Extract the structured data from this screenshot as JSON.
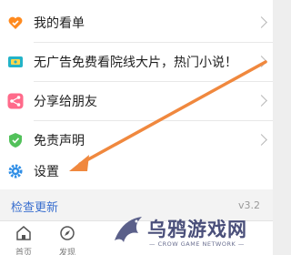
{
  "menu": {
    "items": [
      {
        "label": "我的看单",
        "icon": "heart-icon",
        "color": "#ff8a1f"
      },
      {
        "label": "无广告免费看院线大片，热门小说！",
        "icon": "ticket-icon",
        "color": "#23b3c8"
      },
      {
        "label": "分享给朋友",
        "icon": "share-icon",
        "color": "#ff6a8a"
      },
      {
        "label": "免责声明",
        "icon": "shield-icon",
        "color": "#52c15a"
      },
      {
        "label": "设置",
        "icon": "gear-icon",
        "color": "#2f8ee6"
      }
    ]
  },
  "check_update": {
    "label": "检查更新",
    "version": "v3.2"
  },
  "tabbar": {
    "tabs": [
      {
        "label": "首页",
        "icon": "home-icon"
      },
      {
        "label": "发现",
        "icon": "discover-icon"
      }
    ]
  },
  "watermark": {
    "title": "乌鸦游戏网",
    "subtitle": "— CROW GAME NETWORK —"
  },
  "annotation": {
    "arrow_color": "#f0883e"
  }
}
